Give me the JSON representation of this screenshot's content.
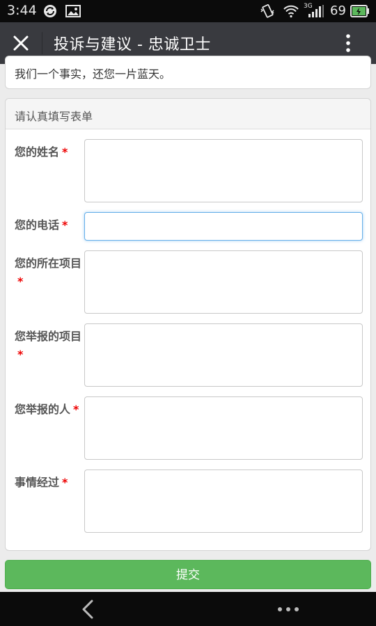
{
  "status_bar": {
    "time": "3:44",
    "network_type": "3G",
    "battery_level": "69",
    "icons": [
      "sync-icon",
      "image-icon",
      "vibrate-icon",
      "wifi-icon",
      "signal-icon",
      "battery-icon"
    ]
  },
  "title_bar": {
    "title": "投诉与建议 - 忠诚卫士",
    "close_icon": "close-icon",
    "more_icon": "more-vertical-icon"
  },
  "intro": {
    "text": "我们一个事实，还您一片蓝天。"
  },
  "form": {
    "heading": "请认真填写表单",
    "required_mark": "*",
    "fields": [
      {
        "label": "您的姓名",
        "value": "",
        "focused": false
      },
      {
        "label": "您的电话",
        "value": "",
        "focused": true
      },
      {
        "label": "您的所在项目",
        "value": "",
        "focused": false
      },
      {
        "label": "您举报的项目",
        "value": "",
        "focused": false
      },
      {
        "label": "您举报的人",
        "value": "",
        "focused": false
      },
      {
        "label": "事情经过",
        "value": "",
        "focused": false
      }
    ],
    "submit_label": "提交"
  },
  "nav_bar": {
    "back_icon": "back-chevron-icon",
    "more_icon": "more-dots-icon"
  },
  "colors": {
    "status_bar_bg": "#0b0b0b",
    "title_bar_bg": "#393a3f",
    "submit_bg": "#5cb85c",
    "required": "#ee0000",
    "focus_border": "#66afe9",
    "battery_charging": "#5cb85c"
  }
}
